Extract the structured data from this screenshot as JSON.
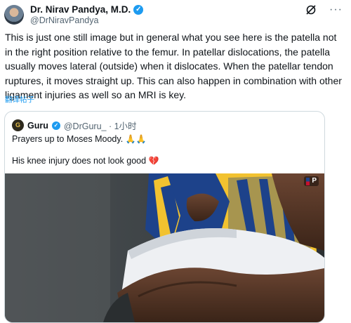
{
  "author": {
    "name": "Dr. Nirav Pandya, M.D.",
    "handle": "@DrNiravPandya",
    "verified_color": "#1d9bf0"
  },
  "header_actions": {
    "grok_icon": "grok-icon",
    "more_label": "···"
  },
  "post": {
    "text": "This is just one still image but in general what you see here is the patella not in the right position relative to the femur. In patellar dislocations, the patella usually moves lateral (outside) when it dislocates.  When the patellar tendon ruptures, it moves straight up.  This can also happen in combination with other ligament injuries as well so an MRI is key.",
    "translate_label": "翻译帖子"
  },
  "quote": {
    "author_name": "Guru",
    "avatar_text": "G",
    "handle_time": "@DrGuru_ · 1小时",
    "line1": "Prayers up to Moses Moody.",
    "line1_emoji": "🙏🙏",
    "line2": "His knee injury does not look good",
    "line2_emoji": "💔"
  },
  "media": {
    "badge_text": "P",
    "colors": {
      "jersey_blue": "#1d428a",
      "jersey_gold": "#f2c230",
      "shorts_white": "#eef0f3",
      "skin": "#5b3a2a",
      "background": "#3c4144"
    }
  }
}
